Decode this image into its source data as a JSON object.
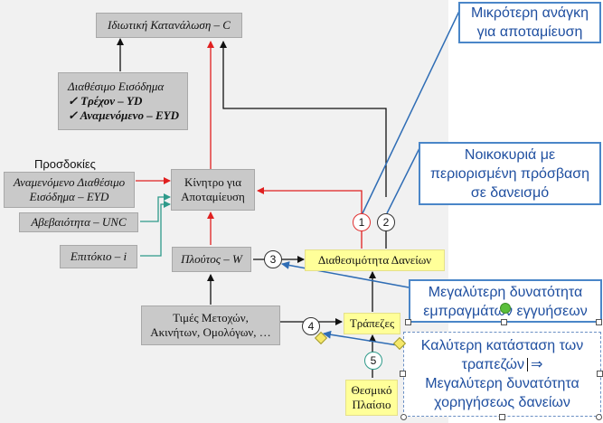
{
  "nodes": {
    "consumption": "Ιδιωτική Κατανάλωση – C",
    "disposable_income": {
      "title": "Διαθέσιμο Εισόδημα",
      "current": "✓ Τρέχον – YD",
      "expected": "✓ Αναμενόμενο – EYD"
    },
    "expectations_label": "Προσδοκίες",
    "expected_income": {
      "line1": "Αναμενόμενο Διαθέσιμο",
      "line2": "Εισόδημα – EYD"
    },
    "uncertainty": "Αβεβαιότητα – UNC",
    "interest_rate": "Επιτόκιο – i",
    "saving_center": {
      "line1": "Κίνητρο για",
      "line2": "Αποταμίευση"
    },
    "wealth": "Πλούτος – W",
    "loan_availability": "Διαθεσιμότητα Δανείων",
    "asset_prices": {
      "line1": "Τιμές Μετοχών,",
      "line2": "Ακινήτων, Ομολόγων, …"
    },
    "banks": "Τράπεζες",
    "institutional_framework": {
      "line1": "Θεσμικό",
      "line2": "Πλαίσιο"
    }
  },
  "circles": {
    "c1": "1",
    "c2": "2",
    "c3": "3",
    "c4": "4",
    "c5": "5"
  },
  "callouts": {
    "less_saving": {
      "line1": "Μικρότερη ανάγκη",
      "line2": "για αποταμίευση"
    },
    "households_limited": {
      "line1": "Νοικοκυριά με",
      "line2": "περιορισμένη πρόσβαση",
      "line3": "σε δανεισμό"
    },
    "collateral": {
      "line1": "Μεγαλύτερη δυνατότητα",
      "line2": "εμπραγμάτων εγγυήσεων"
    },
    "bank_condition": {
      "line1": "Καλύτερη κατάσταση των",
      "line2": "τραπεζών",
      "arrow": "⇒",
      "line3": "Μεγαλύτερη δυνατότητα",
      "line4": "χορηγήσεως δανείων"
    }
  },
  "colors": {
    "red_arrow": "#e02020",
    "black_arrow": "#111111",
    "teal_arrow": "#2e9a8a",
    "blue_connector": "#2f6db5",
    "gray_box": "#c9c9c9",
    "yellow_box": "#ffff99",
    "callout_text": "#1f4fa0"
  }
}
